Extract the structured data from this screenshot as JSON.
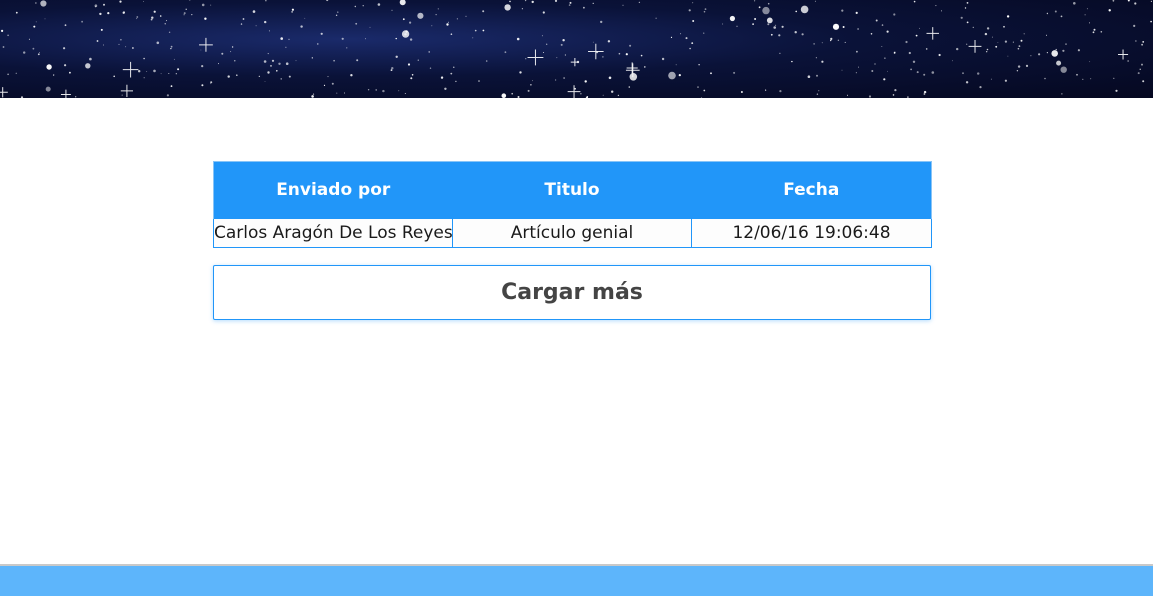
{
  "table": {
    "headers": [
      "Enviado por",
      "Titulo",
      "Fecha"
    ],
    "rows": [
      [
        "Carlos Aragón De Los Reyes",
        "Artículo genial",
        "12/06/16 19:06:48"
      ]
    ]
  },
  "load_more": {
    "label": "Cargar más"
  },
  "colors": {
    "accent": "#2196f9",
    "footer": "#5db5fb",
    "banner": "#0a1238"
  }
}
